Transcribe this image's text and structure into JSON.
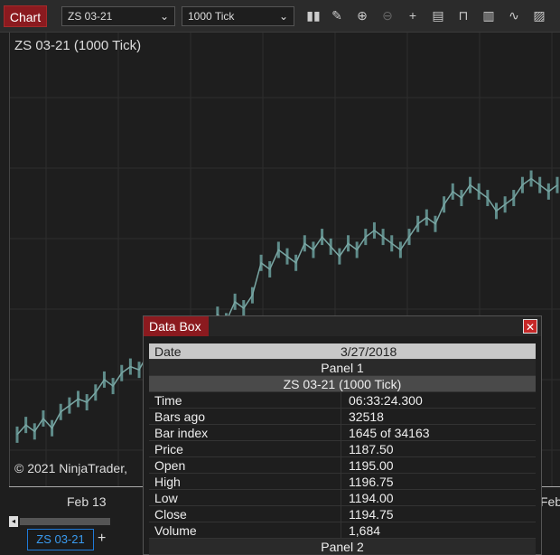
{
  "toolbar": {
    "chart_tab": "Chart",
    "instrument": "ZS 03-21",
    "interval": "1000 Tick",
    "icons": [
      "bar-style-icon",
      "pencil-icon",
      "zoom-in-icon",
      "zoom-out-icon",
      "crosshair-icon",
      "data-box-icon",
      "properties-icon",
      "strategy-icon",
      "indicator-icon",
      "template-icon"
    ]
  },
  "chart": {
    "title": "ZS 03-21 (1000 Tick)",
    "copyright": "© 2021 NinjaTrader,",
    "x_labels": [
      "Feb 13",
      "Feb"
    ],
    "colors": {
      "background": "#1e1e1e",
      "bars": "#5f8c8a",
      "grid": "#2e2e2e"
    }
  },
  "chart_data": {
    "type": "line",
    "series": [
      {
        "values": [
          1183.5,
          1185,
          1184,
          1186,
          1184.5,
          1187,
          1188,
          1189,
          1188.5,
          1190,
          1192,
          1191,
          1193,
          1194,
          1193.5,
          1196,
          1197,
          1196,
          1198,
          1199.5,
          1198,
          1200,
          1199,
          1202,
          1201,
          1204,
          1203,
          1205,
          1210,
          1209,
          1212,
          1211,
          1210,
          1213,
          1212,
          1214,
          1212.5,
          1211,
          1213,
          1212,
          1214,
          1215,
          1214,
          1213,
          1212,
          1214,
          1216,
          1217,
          1216,
          1219,
          1221,
          1220,
          1222,
          1221,
          1220,
          1218,
          1219,
          1220,
          1222,
          1223,
          1222,
          1221,
          1222
        ]
      }
    ],
    "x_ticks": [
      "Feb 13",
      "Feb"
    ]
  },
  "scrollbar": {
    "arrow": "◂"
  },
  "bottom": {
    "series_tab": "ZS 03-21",
    "add_tab": "+"
  },
  "databox": {
    "title": "Data Box",
    "close": "✕",
    "date_label": "Date",
    "date_value": "3/27/2018",
    "panel1": "Panel 1",
    "series_name": "ZS 03-21 (1000 Tick)",
    "rows": [
      {
        "k": "Time",
        "v": "06:33:24.300"
      },
      {
        "k": "Bars ago",
        "v": "32518"
      },
      {
        "k": "Bar index",
        "v": "1645 of 34163"
      },
      {
        "k": "Price",
        "v": "1187.50"
      },
      {
        "k": "Open",
        "v": "1195.00"
      },
      {
        "k": "High",
        "v": "1196.75"
      },
      {
        "k": "Low",
        "v": "1194.00"
      },
      {
        "k": "Close",
        "v": "1194.75"
      },
      {
        "k": "Volume",
        "v": "1,684"
      }
    ],
    "panel2": "Panel 2"
  }
}
